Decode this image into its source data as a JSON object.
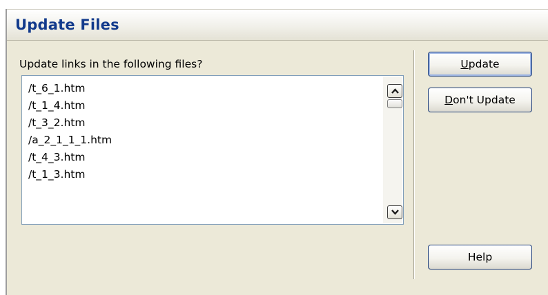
{
  "dialog": {
    "title": "Update Files",
    "prompt": "Update links in the following files?",
    "files": [
      "/t_6_1.htm",
      "/t_1_4.htm",
      "/t_3_2.htm",
      "/a_2_1_1_1.htm",
      "/t_4_3.htm",
      "/t_1_3.htm"
    ],
    "buttons": {
      "update": {
        "mnemonic": "U",
        "rest": "pdate"
      },
      "dont_update": {
        "mnemonic": "D",
        "rest": "on't Update"
      },
      "help": {
        "label": "Help"
      }
    }
  }
}
